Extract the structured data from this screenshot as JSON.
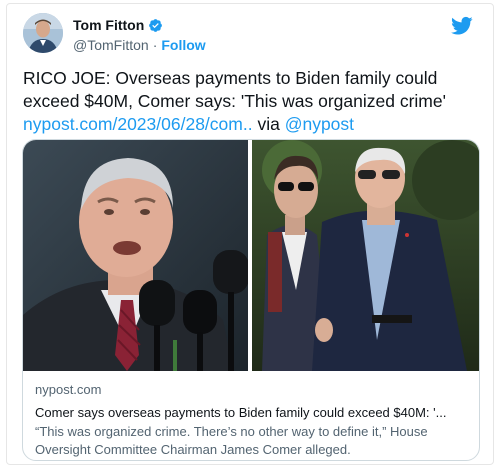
{
  "author": {
    "name": "Tom Fitton",
    "handle": "@TomFitton",
    "separator": "·",
    "follow_label": "Follow",
    "verified": true
  },
  "tweet": {
    "text": "RICO JOE: Overseas payments to Biden family could exceed $40M, Comer says: 'This was organized crime'",
    "link_text": "nypost.com/2023/06/28/com..",
    "via_text": "via",
    "mention": "@nypost"
  },
  "link_card": {
    "domain": "nypost.com",
    "title": "Comer says overseas payments to Biden family could exceed $40M: '...",
    "description": "“This was organized crime. There’s no other way to define it,” House Oversight Committee Chairman James Comer alleged."
  },
  "icons": {
    "brand": "twitter-bird-icon",
    "verified": "verified-badge-icon"
  },
  "colors": {
    "accent": "#1d9bf0",
    "text": "#0f1419",
    "muted": "#536471",
    "border": "#cfd9de"
  }
}
